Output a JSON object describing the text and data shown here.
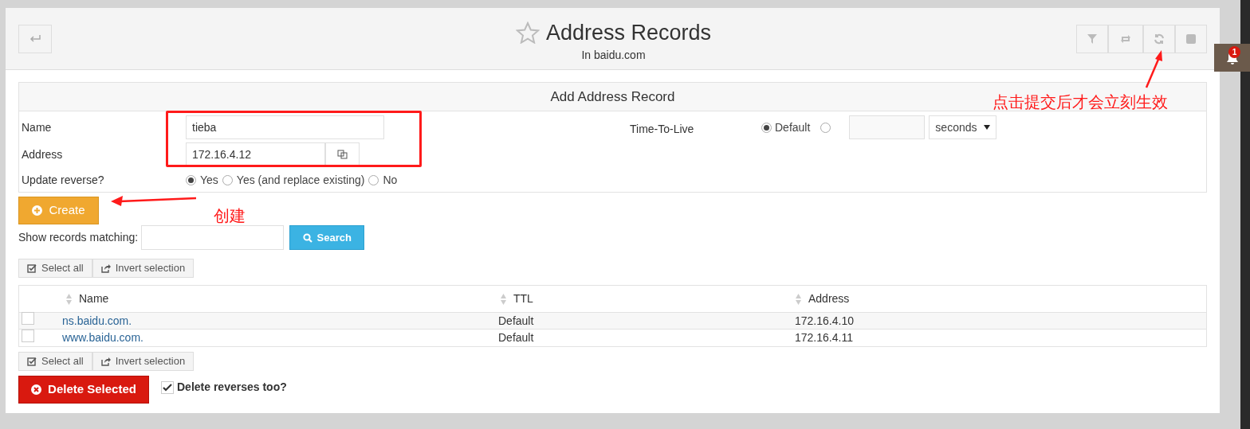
{
  "header": {
    "title": "Address Records",
    "subtitle": "In baidu.com",
    "notification_count": "1"
  },
  "form": {
    "title": "Add Address Record",
    "name": {
      "label": "Name",
      "value": "tieba"
    },
    "address": {
      "label": "Address",
      "value": "172.16.4.12"
    },
    "update_reverse": {
      "label": "Update reverse?",
      "options": [
        {
          "label": "Yes",
          "selected": true
        },
        {
          "label": "Yes (and replace existing)",
          "selected": false
        },
        {
          "label": "No",
          "selected": false
        }
      ]
    },
    "ttl": {
      "label": "Time-To-Live",
      "options": [
        {
          "label": "Default",
          "selected": true
        },
        {
          "selected": false
        }
      ],
      "unit": "seconds"
    },
    "create_button": "Create"
  },
  "search": {
    "label": "Show records matching:",
    "button": "Search"
  },
  "selection_buttons": [
    "Select all",
    "Invert selection"
  ],
  "table": {
    "columns": [
      "Name",
      "TTL",
      "Address"
    ],
    "rows": [
      {
        "checked": false,
        "name": "ns.baidu.com.",
        "ttl": "Default",
        "address": "172.16.4.10"
      },
      {
        "checked": false,
        "name": "www.baidu.com.",
        "ttl": "Default",
        "address": "172.16.4.11"
      }
    ]
  },
  "bottom_selection_buttons": [
    "Select all",
    "Invert selection"
  ],
  "delete_button": "Delete Selected",
  "delete_reverses": {
    "label": "Delete reverses too?",
    "checked": true
  },
  "annotations": [
    {
      "text": "点击提交后才会立刻生效"
    },
    {
      "text": "创建"
    }
  ]
}
